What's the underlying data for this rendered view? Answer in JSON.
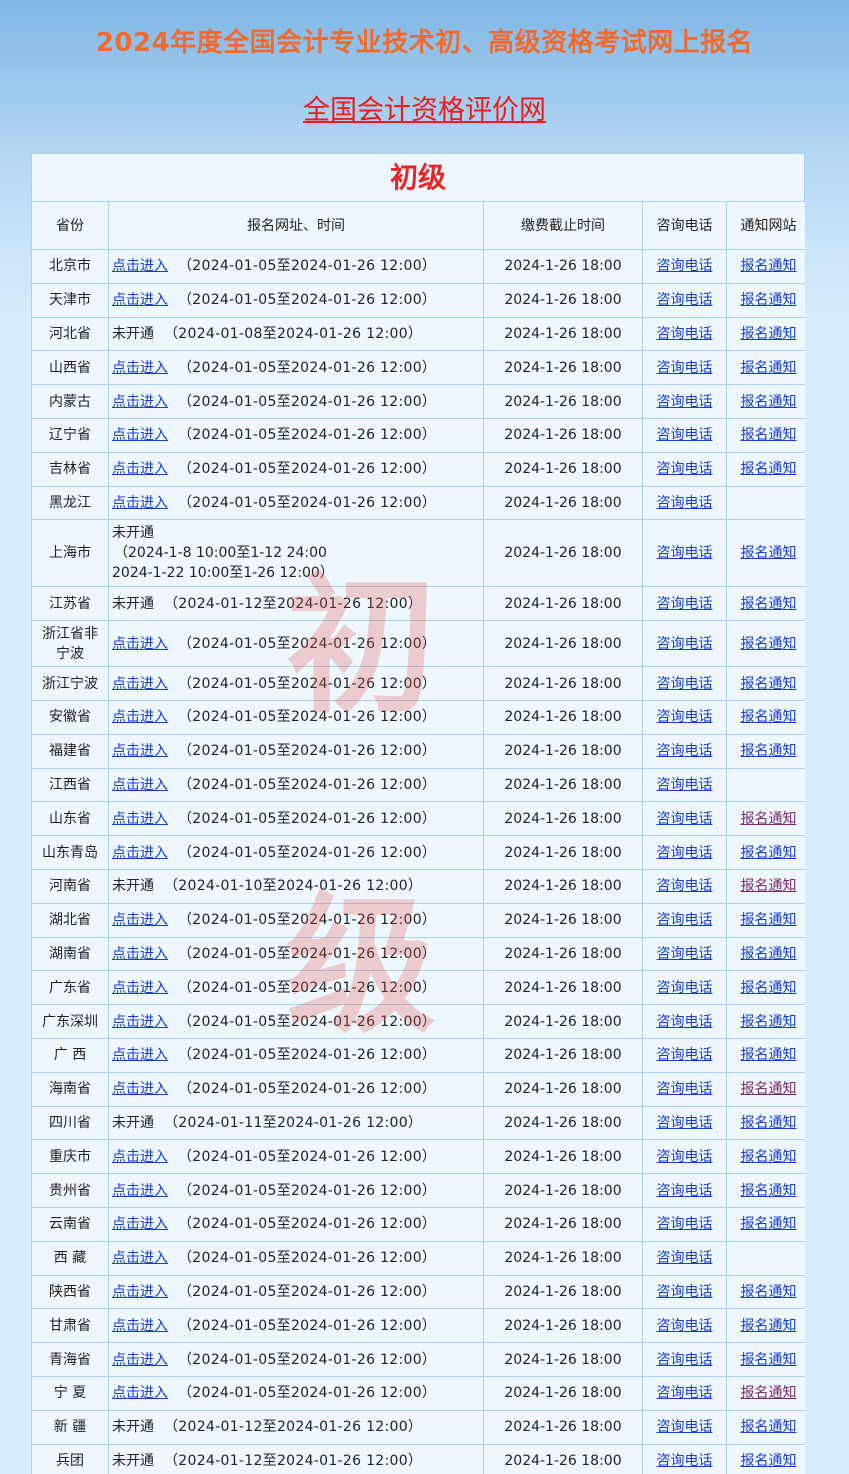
{
  "page_title": "2024年度全国会计专业技术初、高级资格考试网上报名",
  "site_link": "全国会计资格评价网",
  "level_title": "初级",
  "watermark": [
    "初",
    "级"
  ],
  "columns": [
    "省份",
    "报名网址、时间",
    "缴费截止时间",
    "咨询电话",
    "通知网站"
  ],
  "rows": [
    {
      "province": "北京市",
      "status": "点击进入",
      "period": "（2024-01-05至2024-01-26 12:00）",
      "due": "2024-1-26 18:00",
      "tel": "咨询电话",
      "notice": "报名通知"
    },
    {
      "province": "天津市",
      "status": "点击进入",
      "period": "（2024-01-05至2024-01-26 12:00）",
      "due": "2024-1-26 18:00",
      "tel": "咨询电话",
      "notice": "报名通知"
    },
    {
      "province": "河北省",
      "status": "未开通",
      "period": "（2024-01-08至2024-01-26 12:00）",
      "due": "2024-1-26 18:00",
      "tel": "咨询电话",
      "notice": "报名通知"
    },
    {
      "province": "山西省",
      "status": "点击进入",
      "period": "（2024-01-05至2024-01-26 12:00）",
      "due": "2024-1-26 18:00",
      "tel": "咨询电话",
      "notice": "报名通知"
    },
    {
      "province": "内蒙古",
      "status": "点击进入",
      "period": "（2024-01-05至2024-01-26 12:00）",
      "due": "2024-1-26 18:00",
      "tel": "咨询电话",
      "notice": "报名通知"
    },
    {
      "province": "辽宁省",
      "status": "点击进入",
      "period": "（2024-01-05至2024-01-26 12:00）",
      "due": "2024-1-26 18:00",
      "tel": "咨询电话",
      "notice": "报名通知"
    },
    {
      "province": "吉林省",
      "status": "点击进入",
      "period": "（2024-01-05至2024-01-26 12:00）",
      "due": "2024-1-26 18:00",
      "tel": "咨询电话",
      "notice": "报名通知"
    },
    {
      "province": "黑龙江",
      "status": "点击进入",
      "period": "（2024-01-05至2024-01-26 12:00）",
      "due": "2024-1-26 18:00",
      "tel": "咨询电话",
      "notice": ""
    },
    {
      "province": "上海市",
      "status": "未开通",
      "period_lines": [
        "（2024-1-8 10:00至1-12 24:00",
        "2024-1-22 10:00至1-26 12:00）"
      ],
      "due": "2024-1-26 18:00",
      "tel": "咨询电话",
      "notice": "报名通知"
    },
    {
      "province": "江苏省",
      "status": "未开通",
      "period": "（2024-01-12至2024-01-26 12:00）",
      "due": "2024-1-26 18:00",
      "tel": "咨询电话",
      "notice": "报名通知"
    },
    {
      "province_lines": [
        "浙江省非",
        "宁波"
      ],
      "status": "点击进入",
      "period": "（2024-01-05至2024-01-26 12:00）",
      "due": "2024-1-26 18:00",
      "tel": "咨询电话",
      "notice": "报名通知"
    },
    {
      "province": "浙江宁波",
      "status": "点击进入",
      "period": "（2024-01-05至2024-01-26 12:00）",
      "due": "2024-1-26 18:00",
      "tel": "咨询电话",
      "notice": "报名通知"
    },
    {
      "province": "安徽省",
      "status": "点击进入",
      "period": "（2024-01-05至2024-01-26 12:00）",
      "due": "2024-1-26 18:00",
      "tel": "咨询电话",
      "notice": "报名通知"
    },
    {
      "province": "福建省",
      "status": "点击进入",
      "period": "（2024-01-05至2024-01-26 12:00）",
      "due": "2024-1-26 18:00",
      "tel": "咨询电话",
      "notice": "报名通知"
    },
    {
      "province": "江西省",
      "status": "点击进入",
      "period": "（2024-01-05至2024-01-26 12:00）",
      "due": "2024-1-26 18:00",
      "tel": "咨询电话",
      "notice": ""
    },
    {
      "province": "山东省",
      "status": "点击进入",
      "period": "（2024-01-05至2024-01-26 12:00）",
      "due": "2024-1-26 18:00",
      "tel": "咨询电话",
      "notice": "报名通知",
      "notice_visited": true
    },
    {
      "province": "山东青岛",
      "status": "点击进入",
      "period": "（2024-01-05至2024-01-26 12:00）",
      "due": "2024-1-26 18:00",
      "tel": "咨询电话",
      "notice": "报名通知"
    },
    {
      "province": "河南省",
      "status": "未开通",
      "period": "（2024-01-10至2024-01-26 12:00）",
      "due": "2024-1-26 18:00",
      "tel": "咨询电话",
      "notice": "报名通知",
      "notice_visited": true
    },
    {
      "province": "湖北省",
      "status": "点击进入",
      "period": "（2024-01-05至2024-01-26 12:00）",
      "due": "2024-1-26 18:00",
      "tel": "咨询电话",
      "notice": "报名通知"
    },
    {
      "province": "湖南省",
      "status": "点击进入",
      "period": "（2024-01-05至2024-01-26 12:00）",
      "due": "2024-1-26 18:00",
      "tel": "咨询电话",
      "notice": "报名通知"
    },
    {
      "province": "广东省",
      "status": "点击进入",
      "period": "（2024-01-05至2024-01-26 12:00）",
      "due": "2024-1-26 18:00",
      "tel": "咨询电话",
      "notice": "报名通知"
    },
    {
      "province": "广东深圳",
      "status": "点击进入",
      "period": "（2024-01-05至2024-01-26 12:00）",
      "due": "2024-1-26 18:00",
      "tel": "咨询电话",
      "notice": "报名通知"
    },
    {
      "province": "广 西",
      "status": "点击进入",
      "period": "（2024-01-05至2024-01-26 12:00）",
      "due": "2024-1-26 18:00",
      "tel": "咨询电话",
      "notice": "报名通知"
    },
    {
      "province": "海南省",
      "status": "点击进入",
      "period": "（2024-01-05至2024-01-26 12:00）",
      "due": "2024-1-26 18:00",
      "tel": "咨询电话",
      "notice": "报名通知",
      "notice_visited": true
    },
    {
      "province": "四川省",
      "status": "未开通",
      "period": "（2024-01-11至2024-01-26 12:00）",
      "due": "2024-1-26 18:00",
      "tel": "咨询电话",
      "notice": "报名通知"
    },
    {
      "province": "重庆市",
      "status": "点击进入",
      "period": "（2024-01-05至2024-01-26 12:00）",
      "due": "2024-1-26 18:00",
      "tel": "咨询电话",
      "notice": "报名通知"
    },
    {
      "province": "贵州省",
      "status": "点击进入",
      "period": "（2024-01-05至2024-01-26 12:00）",
      "due": "2024-1-26 18:00",
      "tel": "咨询电话",
      "notice": "报名通知"
    },
    {
      "province": "云南省",
      "status": "点击进入",
      "period": "（2024-01-05至2024-01-26 12:00）",
      "due": "2024-1-26 18:00",
      "tel": "咨询电话",
      "notice": "报名通知"
    },
    {
      "province": "西 藏",
      "status": "点击进入",
      "period": "（2024-01-05至2024-01-26 12:00）",
      "due": "2024-1-26 18:00",
      "tel": "咨询电话",
      "notice": ""
    },
    {
      "province": "陕西省",
      "status": "点击进入",
      "period": "（2024-01-05至2024-01-26 12:00）",
      "due": "2024-1-26 18:00",
      "tel": "咨询电话",
      "notice": "报名通知"
    },
    {
      "province": "甘肃省",
      "status": "点击进入",
      "period": "（2024-01-05至2024-01-26 12:00）",
      "due": "2024-1-26 18:00",
      "tel": "咨询电话",
      "notice": "报名通知"
    },
    {
      "province": "青海省",
      "status": "点击进入",
      "period": "（2024-01-05至2024-01-26 12:00）",
      "due": "2024-1-26 18:00",
      "tel": "咨询电话",
      "notice": "报名通知"
    },
    {
      "province": "宁 夏",
      "status": "点击进入",
      "period": "（2024-01-05至2024-01-26 12:00）",
      "due": "2024-1-26 18:00",
      "tel": "咨询电话",
      "notice": "报名通知",
      "notice_visited": true
    },
    {
      "province": "新 疆",
      "status": "未开通",
      "period": "（2024-01-12至2024-01-26 12:00）",
      "due": "2024-1-26 18:00",
      "tel": "咨询电话",
      "notice": "报名通知"
    },
    {
      "province": "兵团",
      "status": "未开通",
      "period": "（2024-01-12至2024-01-26 12:00）",
      "due": "2024-1-26 18:00",
      "tel": "咨询电话",
      "notice": "报名通知"
    }
  ],
  "colors": {
    "link": "#1a3ed1",
    "visited": "#7b2b6b",
    "title": "#f26a2e",
    "red": "#e8262a",
    "border": "#a9d2ee"
  }
}
